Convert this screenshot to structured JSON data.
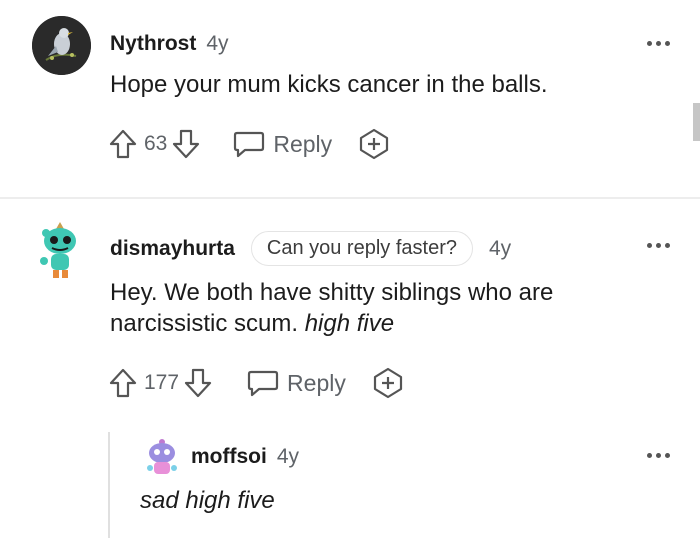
{
  "comments": [
    {
      "username": "Nythrost",
      "age": "4y",
      "body": "Hope your mum kicks cancer in the balls.",
      "score": "63",
      "reply_label": "Reply"
    },
    {
      "username": "dismayhurta",
      "flair": "Can you reply faster?",
      "age": "4y",
      "body_plain": "Hey. We both have shitty siblings who are narcissistic scum.",
      "body_italic": "high five",
      "score": "177",
      "reply_label": "Reply"
    },
    {
      "username": "moffsoi",
      "age": "4y",
      "body_italic": "sad high five"
    }
  ],
  "icons": {
    "upvote": "upvote-arrow-icon",
    "downvote": "downvote-arrow-icon",
    "reply": "reply-bubble-icon",
    "award": "award-plus-icon",
    "more": "more-options-icon"
  },
  "colors": {
    "text": "#1c1c1c",
    "muted": "#5f6368",
    "divider": "#ededed"
  }
}
